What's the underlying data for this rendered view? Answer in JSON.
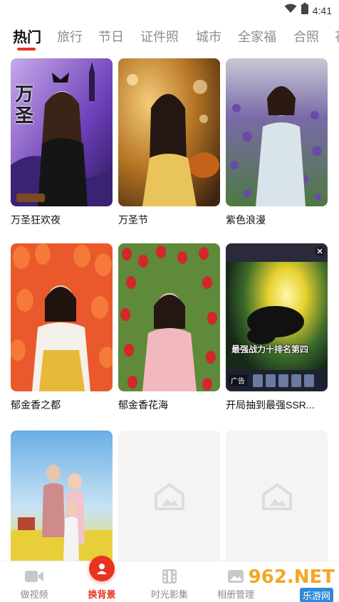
{
  "status": {
    "time": "4:41"
  },
  "tabs": [
    {
      "label": "热门",
      "active": true
    },
    {
      "label": "旅行"
    },
    {
      "label": "节日"
    },
    {
      "label": "证件照"
    },
    {
      "label": "城市"
    },
    {
      "label": "全家福"
    },
    {
      "label": "合照"
    },
    {
      "label": "花"
    }
  ],
  "cards": [
    {
      "title": "万圣狂欢夜",
      "overlay_text": "万圣"
    },
    {
      "title": "万圣节"
    },
    {
      "title": "紫色浪漫"
    },
    {
      "title": "郁金香之都"
    },
    {
      "title": "郁金香花海"
    },
    {
      "title": "开局抽到最强SSR...",
      "overlay_text": "最强战力十排名第四",
      "ad_label": "广告"
    },
    {
      "title": ""
    },
    {
      "title": ""
    },
    {
      "title": ""
    }
  ],
  "bottom_nav": [
    {
      "label": "做视频",
      "icon": "video-camera-icon"
    },
    {
      "label": "换背景",
      "icon": "person-swap-icon",
      "active": true
    },
    {
      "label": "时光影集",
      "icon": "film-album-icon"
    },
    {
      "label": "相册管理",
      "icon": "photo-album-icon"
    }
  ],
  "watermark": {
    "text": "962.NET",
    "sub": "乐游网"
  },
  "colors": {
    "accent": "#e8331f",
    "tab_inactive": "#8d8d8d",
    "placeholder": "#f4f4f4"
  }
}
